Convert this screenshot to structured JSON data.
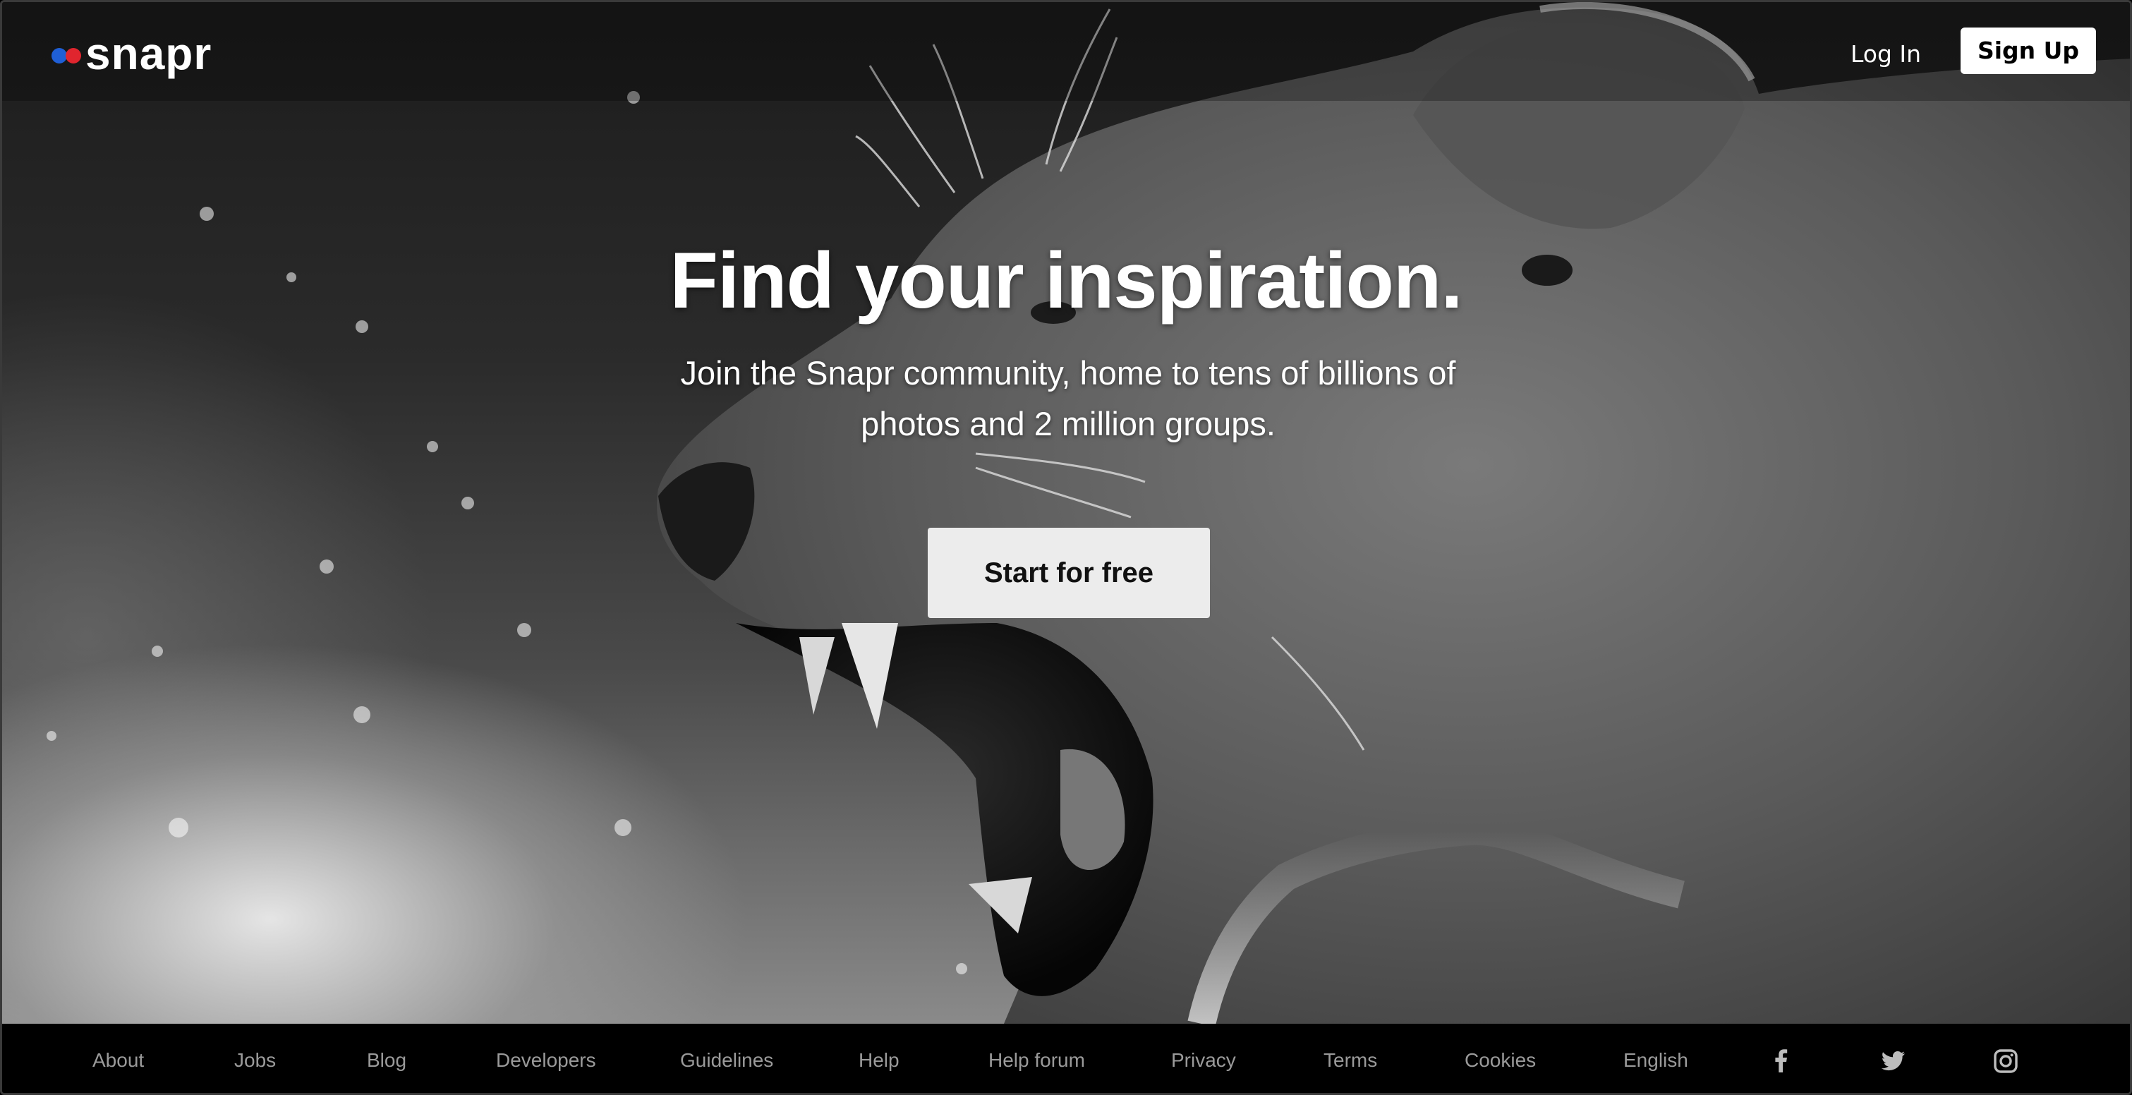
{
  "header": {
    "logo_text": "snapr",
    "logo_colors": {
      "left_dot": "#1f5fd6",
      "right_dot": "#e0252e"
    },
    "login_label": "Log In",
    "signup_label": "Sign Up"
  },
  "hero": {
    "headline": "Find your inspiration.",
    "subheadline": "Join the Snapr community, home to tens of billions of photos and 2 million groups.",
    "cta_label": "Start for free",
    "background": "black-and-white photo of a roaring lioness"
  },
  "footer": {
    "links": [
      "About",
      "Jobs",
      "Blog",
      "Developers",
      "Guidelines",
      "Help",
      "Help forum",
      "Privacy",
      "Terms",
      "Cookies",
      "English"
    ],
    "social_icons": [
      "facebook-icon",
      "twitter-icon",
      "instagram-icon"
    ]
  }
}
